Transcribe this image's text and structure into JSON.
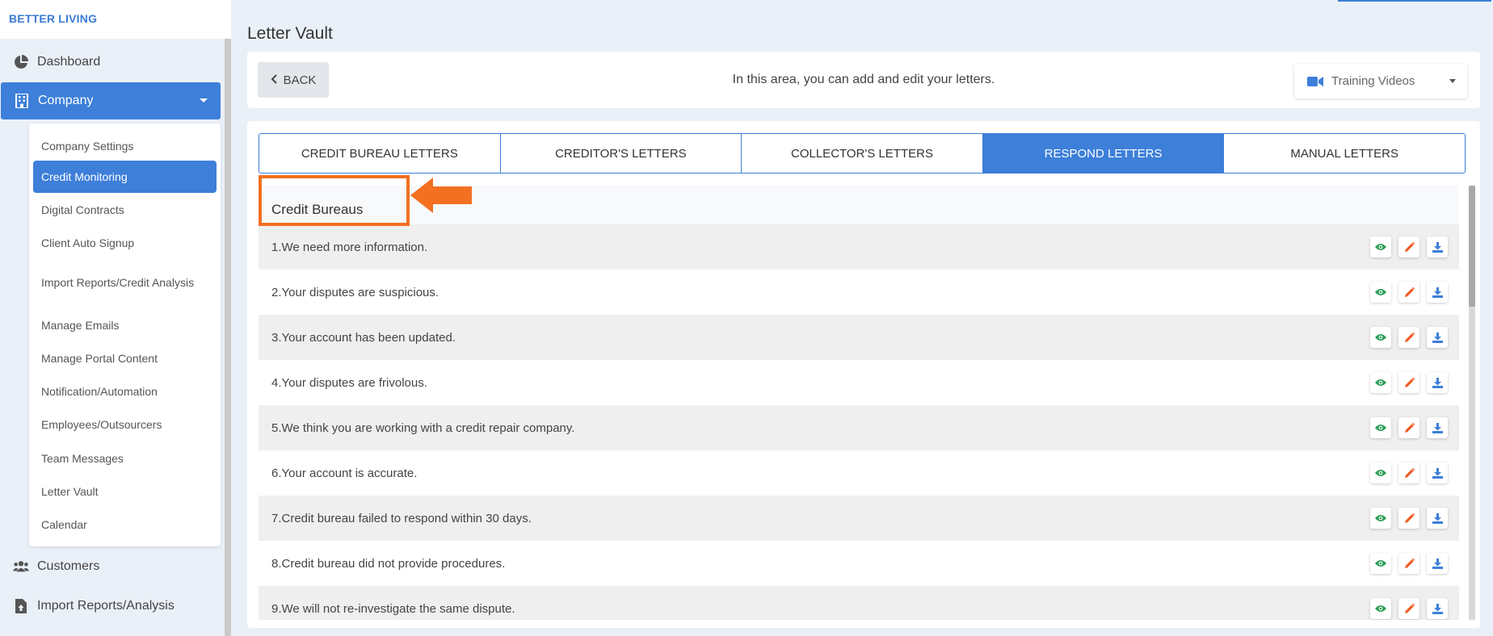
{
  "brand": "BETTER LIVING",
  "sidebar": {
    "items": [
      {
        "label": "Dashboard",
        "icon": "pie-chart-icon"
      },
      {
        "label": "Company",
        "icon": "building-icon"
      },
      {
        "label": "Customers",
        "icon": "users-icon"
      },
      {
        "label": "Import Reports/Analysis",
        "icon": "file-upload-icon"
      }
    ],
    "submenu": [
      "Company Settings",
      "Credit Monitoring",
      "Digital Contracts",
      "Client Auto Signup",
      "Import Reports/Credit Analysis",
      "Manage Emails",
      "Manage Portal Content",
      "Notification/Automation",
      "Employees/Outsourcers",
      "Team Messages",
      "Letter Vault",
      "Calendar"
    ],
    "active_submenu": "Credit Monitoring"
  },
  "page": {
    "title": "Letter Vault",
    "back_label": "BACK",
    "intro": "In this area, you can add and edit your letters.",
    "training_label": "Training Videos"
  },
  "tabs": [
    "CREDIT BUREAU LETTERS",
    "CREDITOR'S LETTERS",
    "COLLECTOR'S LETTERS",
    "RESPOND LETTERS",
    "MANUAL LETTERS"
  ],
  "active_tab": "RESPOND LETTERS",
  "list": {
    "header": "Credit Bureaus",
    "letters": [
      "1.We need more information.",
      "2.Your disputes are suspicious.",
      "3.Your account has been updated.",
      "4.Your disputes are frivolous.",
      "5.We think you are working with a credit repair company.",
      "6.Your account is accurate.",
      "7.Credit bureau failed to respond within 30 days.",
      "8.Credit bureau did not provide procedures.",
      "9.We will not re-investigate the same dispute."
    ],
    "action_icons": [
      "eye-icon",
      "pencil-icon",
      "download-icon"
    ]
  },
  "colors": {
    "accent": "#3d7fd9",
    "annotation": "#f37021",
    "view_icon": "#2a9d55",
    "edit_icon": "#f05a22",
    "download_icon": "#3d7fd9"
  }
}
